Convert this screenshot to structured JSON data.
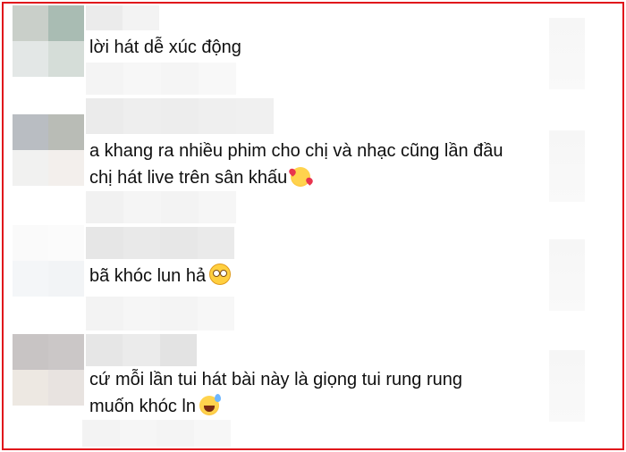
{
  "comments": [
    {
      "text": "lời hát dễ xúc động"
    },
    {
      "line1": "a khang ra nhiều phim cho chị và nhạc cũng lần đầu",
      "line2": "chị hát live trên sân khấu",
      "emoji": "smiling-face-with-hearts-icon"
    },
    {
      "text": "bã khóc lun hả",
      "emoji": "flushed-face-icon"
    },
    {
      "line1": "cứ mỗi lần tui hát bài này là giọng tui rung rung",
      "line2": "muốn khóc ln",
      "emoji": "grinning-face-with-sweat-icon"
    }
  ],
  "colors": {
    "border": "#e0141b",
    "text": "#0f0f0f"
  }
}
